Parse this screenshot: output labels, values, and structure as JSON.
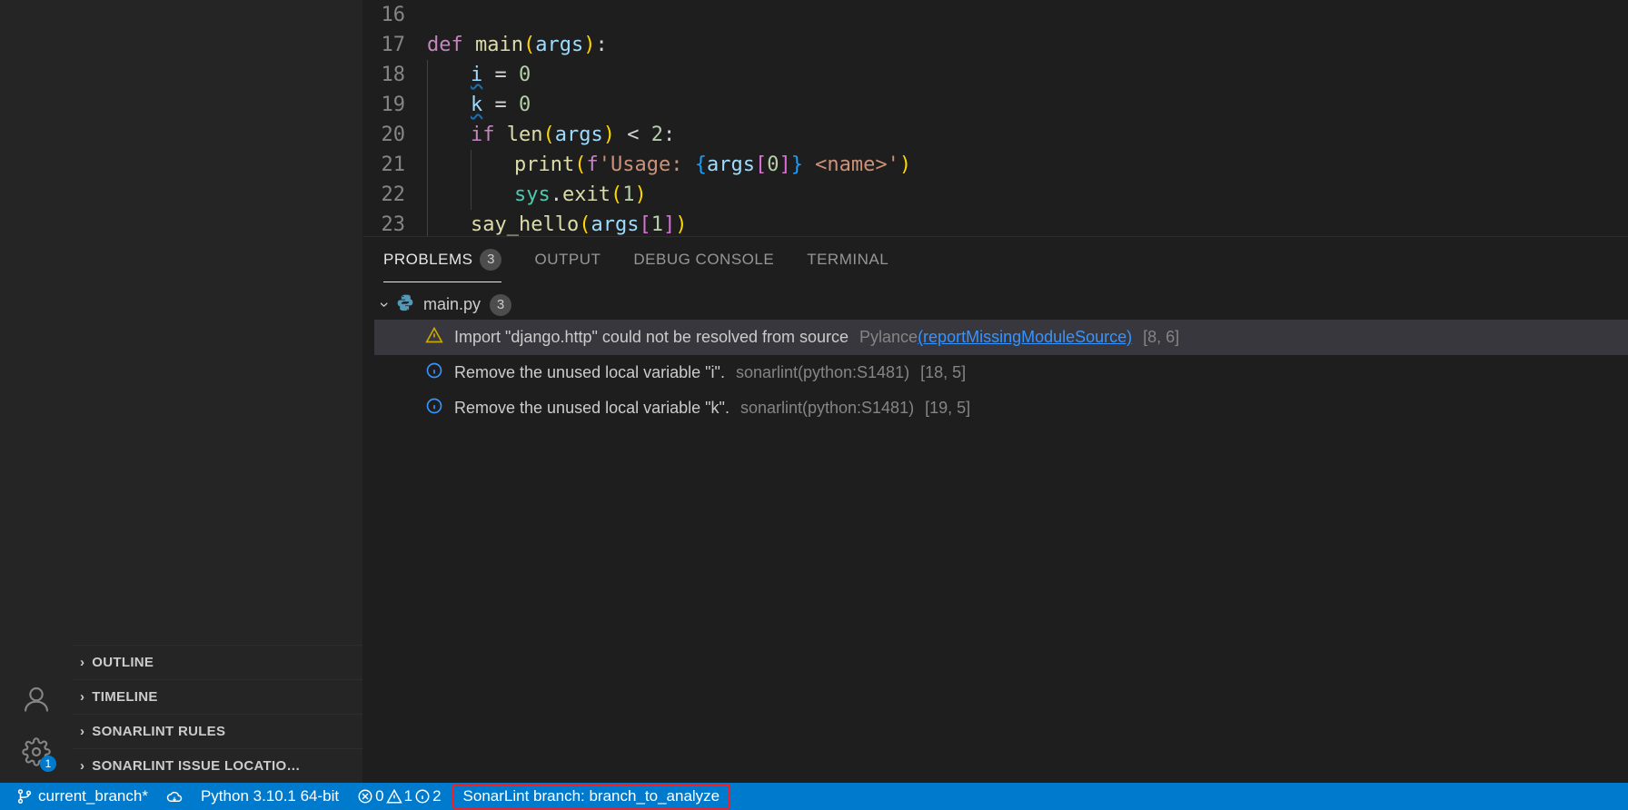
{
  "editor": {
    "lines": [
      {
        "num": "16",
        "tokens": []
      },
      {
        "num": "17",
        "tokens": [
          [
            "kw",
            "def "
          ],
          [
            "fn",
            "main"
          ],
          [
            "paren",
            "("
          ],
          [
            "param",
            "args"
          ],
          [
            "paren",
            ")"
          ],
          [
            "op",
            ":"
          ]
        ]
      },
      {
        "num": "18",
        "indent": 1,
        "tokens": [
          [
            "var squiggle",
            "i"
          ],
          [
            "op",
            " = "
          ],
          [
            "num",
            "0"
          ]
        ]
      },
      {
        "num": "19",
        "indent": 1,
        "tokens": [
          [
            "var squiggle",
            "k"
          ],
          [
            "op",
            " = "
          ],
          [
            "num",
            "0"
          ]
        ]
      },
      {
        "num": "20",
        "indent": 1,
        "tokens": [
          [
            "kw",
            "if"
          ],
          [
            "op",
            " "
          ],
          [
            "builtinFn",
            "len"
          ],
          [
            "paren",
            "("
          ],
          [
            "var",
            "args"
          ],
          [
            "paren",
            ")"
          ],
          [
            "op",
            " < "
          ],
          [
            "num",
            "2"
          ],
          [
            "op",
            ":"
          ]
        ]
      },
      {
        "num": "21",
        "indent": 2,
        "tokens": [
          [
            "builtinFn",
            "print"
          ],
          [
            "paren",
            "("
          ],
          [
            "kw",
            "f"
          ],
          [
            "str",
            "'Usage: "
          ],
          [
            "paren3",
            "{"
          ],
          [
            "var",
            "args"
          ],
          [
            "paren2",
            "["
          ],
          [
            "num",
            "0"
          ],
          [
            "paren2",
            "]"
          ],
          [
            "paren3",
            "}"
          ],
          [
            "str",
            " <name>'"
          ],
          [
            "paren",
            ")"
          ]
        ]
      },
      {
        "num": "22",
        "indent": 2,
        "tokens": [
          [
            "obj",
            "sys"
          ],
          [
            "op",
            "."
          ],
          [
            "method",
            "exit"
          ],
          [
            "paren",
            "("
          ],
          [
            "num",
            "1"
          ],
          [
            "paren",
            ")"
          ]
        ]
      },
      {
        "num": "23",
        "indent": 1,
        "tokens": [
          [
            "fn",
            "say_hello"
          ],
          [
            "paren",
            "("
          ],
          [
            "var",
            "args"
          ],
          [
            "paren2",
            "["
          ],
          [
            "num",
            "1"
          ],
          [
            "paren2",
            "]"
          ],
          [
            "paren",
            ")"
          ]
        ]
      }
    ]
  },
  "panel": {
    "tabs": {
      "problems": "PROBLEMS",
      "problems_count": "3",
      "output": "OUTPUT",
      "debug": "DEBUG CONSOLE",
      "terminal": "TERMINAL"
    },
    "file": {
      "name": "main.py",
      "count": "3"
    },
    "problems": [
      {
        "severity": "warning",
        "message": "Import \"django.http\" could not be resolved from source",
        "source_prefix": "Pylance",
        "source_link": "(reportMissingModuleSource)",
        "location": "[8, 6]",
        "selected": true
      },
      {
        "severity": "info",
        "message": "Remove the unused local variable \"i\".",
        "source": "sonarlint(python:S1481)",
        "location": "[18, 5]"
      },
      {
        "severity": "info",
        "message": "Remove the unused local variable \"k\".",
        "source": "sonarlint(python:S1481)",
        "location": "[19, 5]"
      }
    ]
  },
  "sidebar": {
    "sections": [
      "OUTLINE",
      "TIMELINE",
      "SONARLINT RULES",
      "SONARLINT ISSUE LOCATIO…"
    ]
  },
  "activity": {
    "settings_badge": "1"
  },
  "status": {
    "branch": "current_branch*",
    "python": "Python 3.10.1 64-bit",
    "errors": "0",
    "warnings": "1",
    "infos": "2",
    "sonarlint": "SonarLint branch: branch_to_analyze"
  }
}
